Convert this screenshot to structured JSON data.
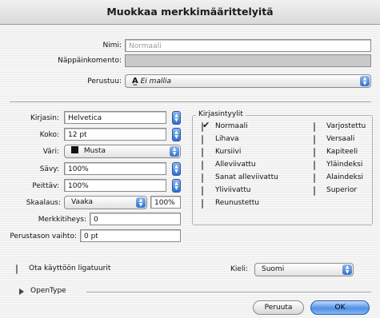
{
  "dialog": {
    "title": "Muokkaa merkkimäärittelyitä"
  },
  "top": {
    "nimi_label": "Nimi:",
    "nimi_value": "Normaali",
    "shortcut_label": "Näppäinkomento:",
    "shortcut_value": "",
    "based_label": "Perustuu:",
    "based_value": "Ei mallia",
    "based_icon": "A-style-icon"
  },
  "font": {
    "kirjasin_label": "Kirjasin:",
    "kirjasin_value": "Helvetica",
    "koko_label": "Koko:",
    "koko_value": "12 pt",
    "vari_label": "Väri:",
    "vari_value": "Musta",
    "vari_swatch": "#111111",
    "savy_label": "Sävy:",
    "savy_value": "100%",
    "peittav_label": "Peittäv:",
    "peittav_value": "100%",
    "skaalaus_label": "Skaalaus:",
    "skaalaus_value": "Vaaka",
    "skaalaus_pct": "100%",
    "merkkitiheys_label": "Merkkitiheys:",
    "merkkitiheys_value": "0",
    "perustaso_label": "Perustason vaihto:",
    "perustaso_value": "0 pt"
  },
  "styles": {
    "title": "Kirjasintyylit",
    "left": [
      {
        "label": "Normaali",
        "checked": true
      },
      {
        "label": "Lihava",
        "checked": false
      },
      {
        "label": "Kursiivi",
        "checked": false
      },
      {
        "label": "Alleviivattu",
        "checked": false
      },
      {
        "label": "Sanat alleviivattu",
        "checked": false
      },
      {
        "label": "Yliviivattu",
        "checked": false
      },
      {
        "label": "Reunustettu",
        "checked": false
      }
    ],
    "right": [
      {
        "label": "Varjostettu",
        "checked": false
      },
      {
        "label": "Versaali",
        "checked": false
      },
      {
        "label": "Kapiteeli",
        "checked": false
      },
      {
        "label": "Yläindeksi",
        "checked": false
      },
      {
        "label": "Alaindeksi",
        "checked": false
      },
      {
        "label": "Superior",
        "checked": false
      }
    ]
  },
  "bottom": {
    "ligatures_label": "Ota käyttöön ligatuurit",
    "kieli_label": "Kieli:",
    "kieli_value": "Suomi",
    "opentype_label": "OpenType",
    "cancel_label": "Peruuta",
    "ok_label": "OK"
  }
}
